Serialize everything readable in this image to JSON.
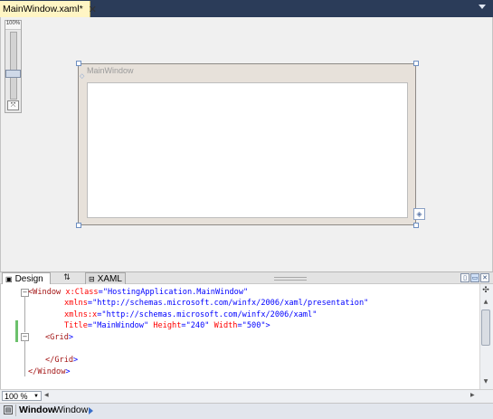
{
  "document_tab": {
    "title": "MainWindow.xaml*",
    "close_glyph": "✕"
  },
  "designer": {
    "zoom_percent": "100%",
    "window_title": "MainWindow"
  },
  "view_tabs": {
    "design_label": "Design",
    "swap_glyph": "⇅",
    "xaml_label": "XAML"
  },
  "xaml_lines": [
    {
      "tag_open": "<Window",
      "attr": " x:Class",
      "eq": "=",
      "value": "\"HostingApplication.MainWindow\""
    },
    {
      "attr": "xmlns",
      "eq": "=",
      "value": "\"http://schemas.microsoft.com/winfx/2006/xaml/presentation\""
    },
    {
      "attr": "xmlns:x",
      "eq": "=",
      "value": "\"http://schemas.microsoft.com/winfx/2006/xaml\""
    },
    {
      "title_attr": "Title",
      "title_val": "\"MainWindow\"",
      "h_attr": " Height",
      "h_val": "\"240\"",
      "w_attr": " Width",
      "w_val": "\"500\"",
      "close": ">"
    },
    {
      "tag_open": "<Grid",
      "close": ">"
    },
    {
      "tag_close": "</Grid",
      "close": ">"
    },
    {
      "tag_close": "</Window",
      "close": ">"
    }
  ],
  "bottom": {
    "zoom_value": "100 %"
  },
  "status": {
    "crumb_bold": "Window",
    "crumb": "Window"
  },
  "colors": {
    "tab_strip": "#2b3c59",
    "active_tab": "#fff5c4",
    "xml_tag": "#a31515",
    "xml_attr": "#ff0000",
    "xml_value": "#0000ff",
    "change_marker": "#6cc16c"
  }
}
